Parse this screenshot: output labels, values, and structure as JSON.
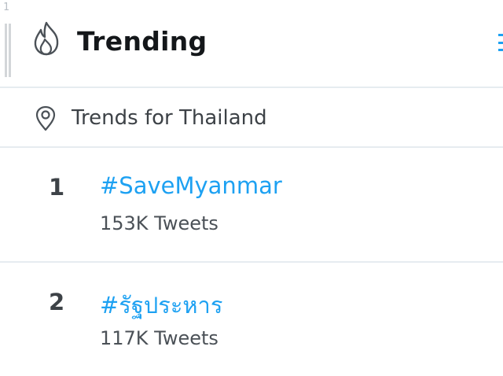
{
  "editor": {
    "line_number": "1"
  },
  "header": {
    "icon": "flame-icon",
    "title": "Trending",
    "accent_color": "#1da1f2"
  },
  "location": {
    "icon": "location-pin-icon",
    "label": "Trends for Thailand"
  },
  "trends": [
    {
      "rank": "1",
      "name": "#SaveMyanmar",
      "count": "153K Tweets"
    },
    {
      "rank": "2",
      "name": "#รัฐประหาร",
      "count": "117K Tweets"
    }
  ],
  "colors": {
    "text_primary": "#14171a",
    "text_secondary": "#4b5157",
    "link_blue": "#1da1f2",
    "divider": "#e6ecf0"
  }
}
